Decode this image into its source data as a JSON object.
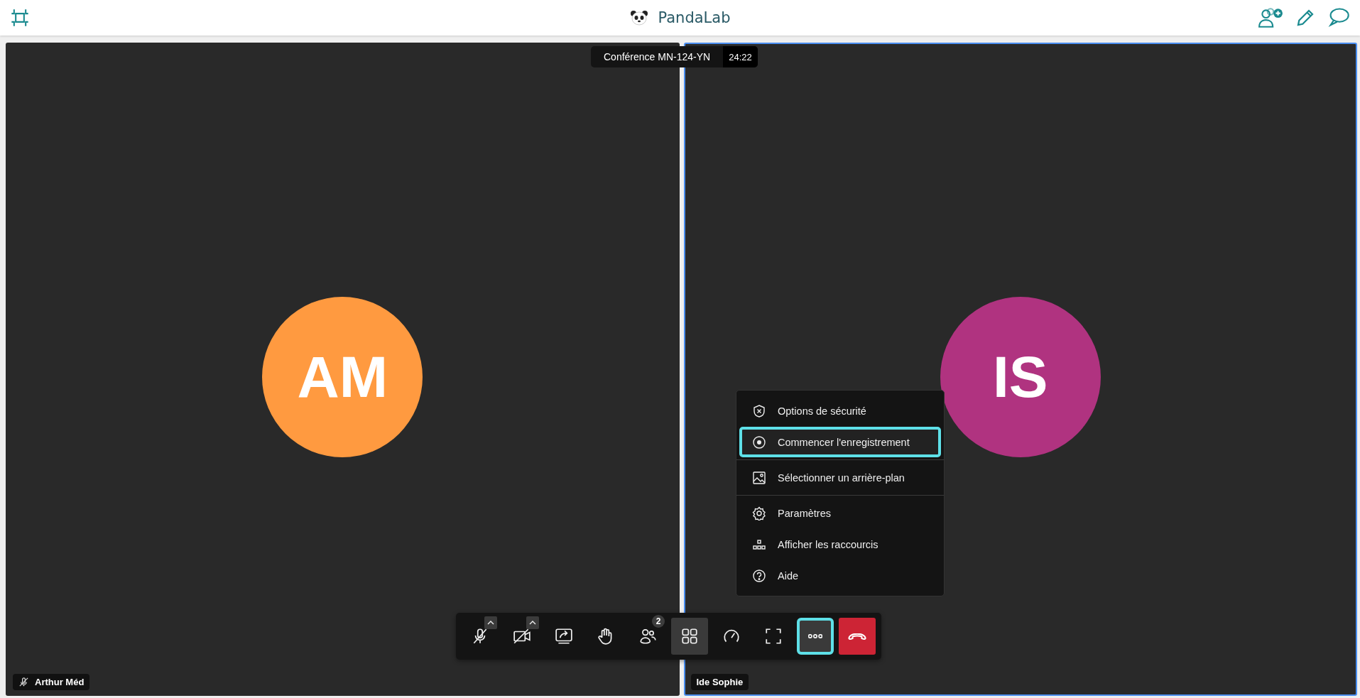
{
  "header": {
    "title": "PandaLab"
  },
  "conference": {
    "title": "Conférence MN-124-YN",
    "timer": "24:22"
  },
  "participants": [
    {
      "initials": "AM",
      "name": "Arthur Méd",
      "color": "#ff9a40",
      "muted": true,
      "active": false
    },
    {
      "initials": "IS",
      "name": "Ide Sophie",
      "color": "#b03380",
      "muted": false,
      "active": true
    }
  ],
  "menu": {
    "sections": [
      [
        {
          "kind": "shield",
          "label": "Options de sécurité",
          "focused": false
        },
        {
          "kind": "record",
          "label": "Commencer l'enregistrement",
          "focused": true
        }
      ],
      [
        {
          "kind": "image",
          "label": "Sélectionner un arrière-plan",
          "focused": false
        }
      ],
      [
        {
          "kind": "gear",
          "label": "Paramètres",
          "focused": false
        },
        {
          "kind": "shortcuts",
          "label": "Afficher les raccourcis",
          "focused": false
        },
        {
          "kind": "help",
          "label": "Aide",
          "focused": false
        }
      ]
    ]
  },
  "toolbar": [
    {
      "kind": "mic-off",
      "has_options": true,
      "selected": false,
      "focused": false
    },
    {
      "kind": "camera-off",
      "has_options": true,
      "selected": false,
      "focused": false
    },
    {
      "kind": "share",
      "has_options": false,
      "selected": false,
      "focused": false
    },
    {
      "kind": "hand",
      "has_options": false,
      "selected": false,
      "focused": false
    },
    {
      "kind": "people",
      "has_options": false,
      "selected": false,
      "focused": false,
      "badge": "2"
    },
    {
      "kind": "grid",
      "has_options": false,
      "selected": true,
      "focused": false
    },
    {
      "kind": "gauge",
      "has_options": false,
      "selected": false,
      "focused": false
    },
    {
      "kind": "fullscreen",
      "has_options": false,
      "selected": false,
      "focused": false
    },
    {
      "kind": "more",
      "has_options": false,
      "selected": true,
      "focused": true
    },
    {
      "kind": "hangup",
      "has_options": false,
      "selected": false,
      "focused": false
    }
  ]
}
